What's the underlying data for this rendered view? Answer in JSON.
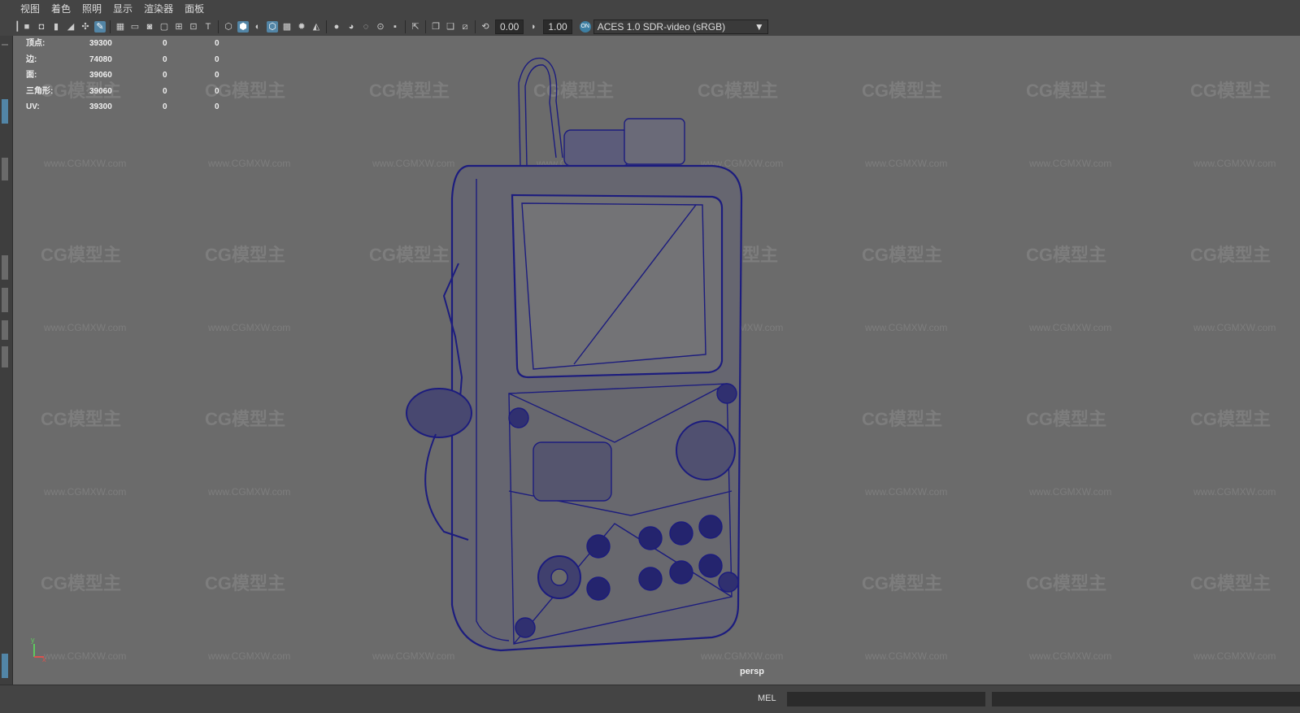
{
  "menu": [
    "视图",
    "着色",
    "照明",
    "显示",
    "渲染器",
    "面板"
  ],
  "toolbar": {
    "exposure": "0.00",
    "gamma": "1.00",
    "color_space": "ACES 1.0 SDR-video (sRGB)",
    "color_space_badge": "ON"
  },
  "hud": {
    "rows": [
      {
        "label": "顶点:",
        "v1": "39300",
        "v2": "0",
        "v3": "0"
      },
      {
        "label": "边:",
        "v1": "74080",
        "v2": "0",
        "v3": "0"
      },
      {
        "label": "面:",
        "v1": "39060",
        "v2": "0",
        "v3": "0"
      },
      {
        "label": "三角形:",
        "v1": "39060",
        "v2": "0",
        "v3": "0"
      },
      {
        "label": "UV:",
        "v1": "39300",
        "v2": "0",
        "v3": "0"
      }
    ]
  },
  "watermark": {
    "logo": "CG模型主",
    "url": "www.CGMXW.com"
  },
  "viewport": {
    "camera": "persp",
    "axis_x": "x",
    "axis_y": "y"
  },
  "commandline": {
    "mode": "MEL"
  },
  "colors": {
    "viewport_bg": "#6b6b6b",
    "wireframe": "#1a1a7a",
    "accent": "#5285a6"
  }
}
